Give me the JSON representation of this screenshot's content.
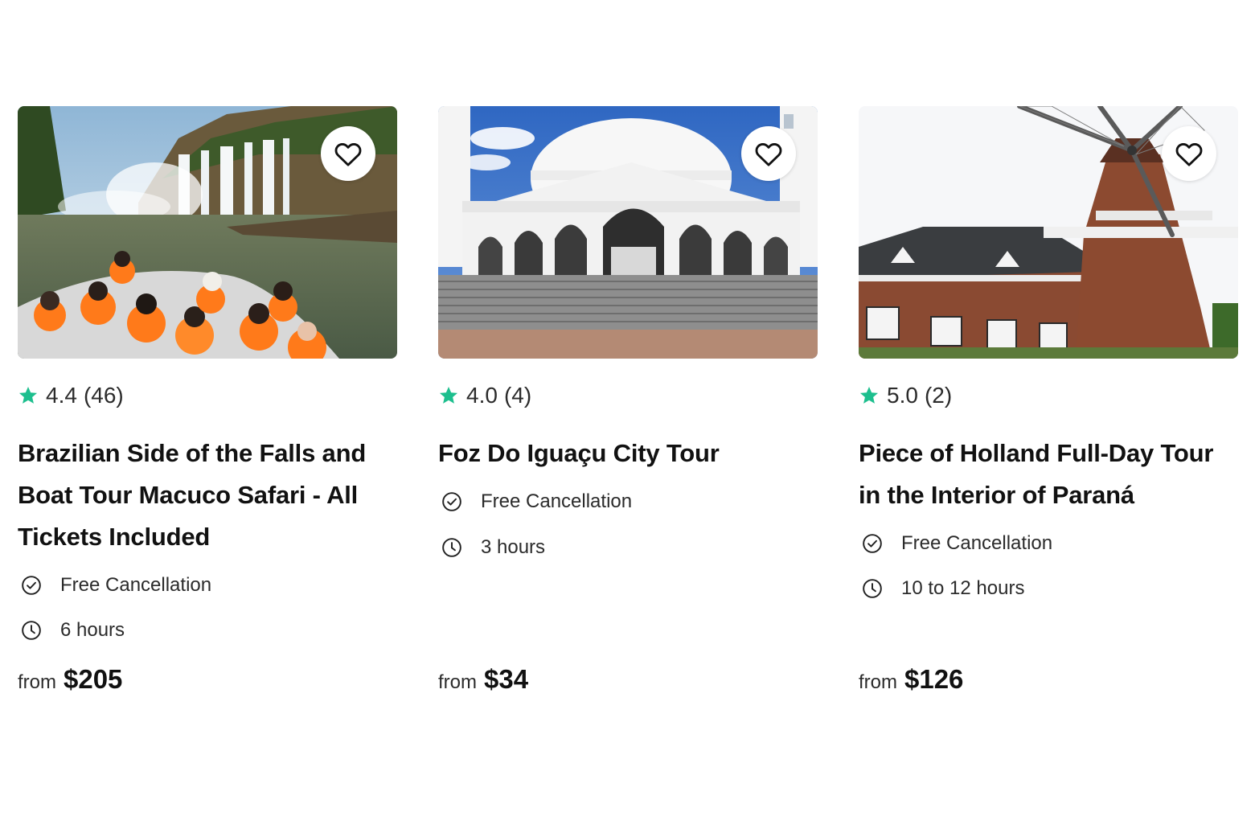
{
  "colors": {
    "star": "#1dbf8e",
    "text": "#1a1a1a"
  },
  "cards": [
    {
      "image": "waterfalls-boat-tour-photo",
      "rating": "4.4",
      "reviews": "(46)",
      "title": "Brazilian Side of the Falls and Boat Tour Macuco Safari - All Tickets Included",
      "cancellation": "Free Cancellation",
      "duration": "6 hours",
      "price_prefix": "from",
      "price": "$205"
    },
    {
      "image": "white-mosque-photo",
      "rating": "4.0",
      "reviews": "(4)",
      "title": "Foz Do Iguaçu City Tour",
      "cancellation": "Free Cancellation",
      "duration": "3 hours",
      "price_prefix": "from",
      "price": "$34"
    },
    {
      "image": "dutch-windmill-photo",
      "rating": "5.0",
      "reviews": "(2)",
      "title": "Piece of Holland Full-Day Tour in the Interior of Paraná",
      "cancellation": "Free Cancellation",
      "duration": "10 to 12 hours",
      "price_prefix": "from",
      "price": "$126"
    }
  ]
}
